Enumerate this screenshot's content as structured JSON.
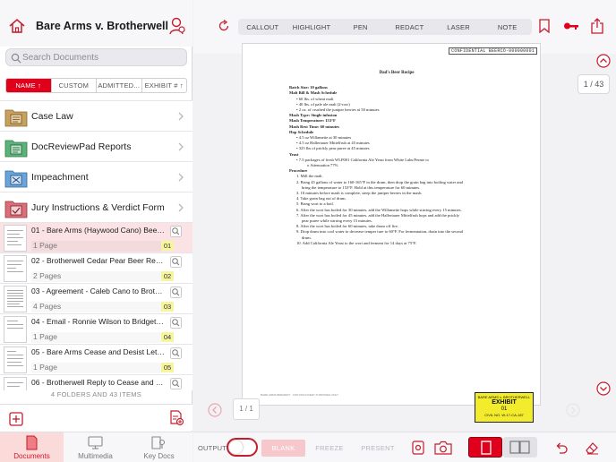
{
  "sidebar": {
    "title": "Bare Arms v. Brotherwell",
    "search_placeholder": "Search Documents",
    "sort": [
      "NAME ↑",
      "CUSTOM",
      "ADMITTED...",
      "EXHIBIT # ↑"
    ],
    "folders": [
      {
        "label": "Case Law",
        "color": "#c9a15f"
      },
      {
        "label": "DocReviewPad Reports",
        "color": "#5bb37a"
      },
      {
        "label": "Impeachment",
        "color": "#6aa4d9"
      },
      {
        "label": "Jury Instructions & Verdict Form",
        "color": "#d86f79"
      }
    ],
    "documents": [
      {
        "title": "01 - Bare Arms (Haywood Cano) Beer Recipe",
        "pages": "1 Page",
        "exhibit": "01",
        "selected": true
      },
      {
        "title": "02 - Brotherwell Cedar Pear Beer Recipe",
        "pages": "2 Pages",
        "exhibit": "02",
        "selected": false
      },
      {
        "title": "03 - Agreement - Caleb Cano to Brotherwell",
        "pages": "4 Pages",
        "exhibit": "03",
        "selected": false
      },
      {
        "title": "04 - Email - Ronnie Wilson to Bridget Johnson",
        "pages": "1 Page",
        "exhibit": "04",
        "selected": false
      },
      {
        "title": "05 - Bare Arms Cease and Desist Letter",
        "pages": "1 Page",
        "exhibit": "05",
        "selected": false
      },
      {
        "title": "06 - Brotherwell Reply to Cease and Desist",
        "pages": "",
        "exhibit": "",
        "selected": false
      }
    ],
    "count": "4 FOLDERS AND 43 ITEMS",
    "tabs": [
      {
        "label": "Documents",
        "icon": "document-icon",
        "active": true
      },
      {
        "label": "Multimedia",
        "icon": "monitor-icon",
        "active": false
      },
      {
        "label": "Key Docs",
        "icon": "key-docs-icon",
        "active": false
      }
    ]
  },
  "toolbar": {
    "annotations": [
      "CALLOUT",
      "HIGHLIGHT",
      "PEN",
      "REDACT",
      "LASER",
      "NOTE"
    ]
  },
  "viewer": {
    "page_counter": "1 / 43",
    "page_of": "1 / 1",
    "confidential": "CONFIDENTIAL BEERCO-000000001",
    "doc_title": "Dad's Beer Recipe",
    "lines": [
      {
        "text": "Batch Size: 10 gallons",
        "cls": "b"
      },
      {
        "text": "Malt Bill & Mash Schedule",
        "cls": "b"
      },
      {
        "text": "•   60 lbs. of wheat malt",
        "cls": "ind1"
      },
      {
        "text": "•   40 lbs. of pale ale malt (2-row)",
        "cls": "ind1"
      },
      {
        "text": "•   2 oz. of crushed the juniper berries at 50 minutes",
        "cls": "ind1"
      },
      {
        "text": "Mash Type: Single infusion",
        "cls": "b"
      },
      {
        "text": "Mash Temperature: 153°F",
        "cls": "b"
      },
      {
        "text": "Mash Rest Time: 60 minutes",
        "cls": "b"
      },
      {
        "text": "Hop Schedule",
        "cls": "b"
      },
      {
        "text": "•   4.5 oz Willamette at 30 minutes",
        "cls": "ind1"
      },
      {
        "text": "•   4.5 oz Hallertauer Mittelfruh at 45 minutes",
        "cls": "ind1"
      },
      {
        "text": "•   325 lbs of prickly pear puree at 45 minutes",
        "cls": "ind1"
      },
      {
        "text": "Yeast",
        "cls": "b"
      },
      {
        "text": "•   7.5 packages of fresh WLP001 California Ale Yeast from White Labs/Ferme  to",
        "cls": "ind1"
      },
      {
        "text": "o   Attenuation 77%",
        "cls": "ind3"
      },
      {
        "text": "Procedure",
        "cls": "b"
      },
      {
        "text": "1.   Mill the malt.",
        "cls": "ind1"
      },
      {
        "text": "2.   Bring 45 gallons of water to 160-165°F in the drum, then drop the grain bag into boiling water and",
        "cls": "ind1"
      },
      {
        "text": "bring the temperature to 153°F. Hold at this temperature for 60 minutes.",
        "cls": "ind2"
      },
      {
        "text": "3.   10 minutes before mash is complete, steep the juniper berries in the mash.",
        "cls": "ind1"
      },
      {
        "text": "4.   Take grain bag out of drum.",
        "cls": "ind1"
      },
      {
        "text": "5.   Bring wort to a boil.",
        "cls": "ind1"
      },
      {
        "text": "6.   After the wort has boiled for 30 minutes, add the Willamette hops while stirring every 15 minutes.",
        "cls": "ind1"
      },
      {
        "text": "7.   After the wort has boiled for 45 minutes, add the Hallertauer Mittelfruh hops and add the prickly",
        "cls": "ind1"
      },
      {
        "text": "pear puree while stirring every 15 minutes.",
        "cls": "ind2"
      },
      {
        "text": "8.   After the wort has boiled for 60 minutes, take drum off fire.",
        "cls": "ind1"
      },
      {
        "text": "9.   Drop drum into cool water to decrease temper  ture to 60°F. For fermentation, drain into the second",
        "cls": "ind1"
      },
      {
        "text": "drum.",
        "cls": "ind2"
      },
      {
        "text": "10. Add California Ale Yeast to the wort and ferment for 14 days at 75°F.",
        "cls": "ind1"
      }
    ],
    "footer": "BARE ARMS BREWERY · FOR DISCOVERY PURPOSES ONLY",
    "exhibit": {
      "case": "BARE ARMS v. BROTHERWELL",
      "label": "EXHIBIT",
      "number": "01",
      "civil": "CIVIL NO. W-17-CA-187"
    }
  },
  "bottombar": {
    "output_label": "OUTPUT",
    "blank": "BLANK",
    "freeze": "FREEZE",
    "present": "PRESENT"
  },
  "colors": {
    "accent": "#e0001b",
    "selected_row": "#fbe3e5",
    "exhibit_badge": "#f6f49c"
  }
}
